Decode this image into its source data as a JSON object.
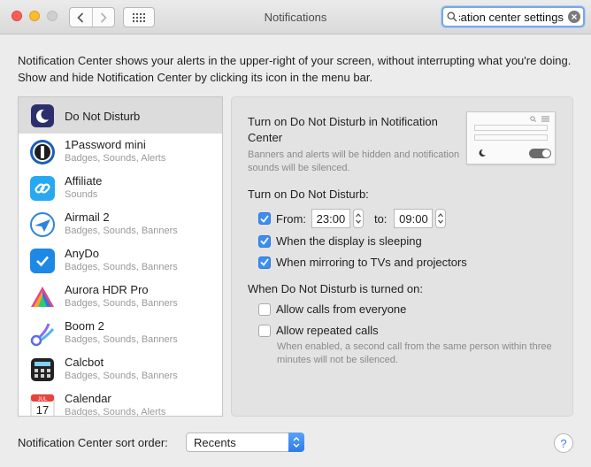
{
  "window": {
    "title": "Notifications",
    "search_value": "Notification center settings"
  },
  "description": "Notification Center shows your alerts in the upper-right of your screen, without interrupting what you're doing. Show and hide Notification Center by clicking its icon in the menu bar.",
  "app_list": [
    {
      "name": "Do Not Disturb",
      "sub": "",
      "icon": "moon-icon",
      "selected": true
    },
    {
      "name": "1Password mini",
      "sub": "Badges, Sounds, Alerts",
      "icon": "1password-icon"
    },
    {
      "name": "Affiliate",
      "sub": "Sounds",
      "icon": "affiliate-icon"
    },
    {
      "name": "Airmail 2",
      "sub": "Badges, Sounds, Banners",
      "icon": "airmail-icon"
    },
    {
      "name": "AnyDo",
      "sub": "Badges, Sounds, Banners",
      "icon": "anydo-icon"
    },
    {
      "name": "Aurora HDR Pro",
      "sub": "Badges, Sounds, Banners",
      "icon": "aurora-icon"
    },
    {
      "name": "Boom 2",
      "sub": "Badges, Sounds, Banners",
      "icon": "boom-icon"
    },
    {
      "name": "Calcbot",
      "sub": "Badges, Sounds, Banners",
      "icon": "calcbot-icon"
    },
    {
      "name": "Calendar",
      "sub": "Badges, Sounds, Alerts",
      "icon": "calendar-icon",
      "calendar_month": "JUL",
      "calendar_day": "17"
    }
  ],
  "dnd": {
    "title": "Turn on Do Not Disturb in Notification Center",
    "note": "Banners and alerts will be hidden and notification sounds will be silenced.",
    "turn_on_heading": "Turn on Do Not Disturb:",
    "from_label": "From:",
    "from_time": "23:00",
    "to_label": "to:",
    "to_time": "09:00",
    "from_checked": true,
    "display_sleeping_label": "When the display is sleeping",
    "display_sleeping_checked": true,
    "mirroring_label": "When mirroring to TVs and projectors",
    "mirroring_checked": true,
    "when_on_heading": "When Do Not Disturb is turned on:",
    "allow_calls_label": "Allow calls from everyone",
    "allow_calls_checked": false,
    "repeated_calls_label": "Allow repeated calls",
    "repeated_calls_checked": false,
    "repeated_hint": "When enabled, a second call from the same person within three minutes will not be silenced."
  },
  "sort": {
    "label": "Notification Center sort order:",
    "value": "Recents"
  },
  "help_label": "?",
  "colors": {
    "accent": "#3c8ef3",
    "selected_row": "#dcdcdc"
  }
}
